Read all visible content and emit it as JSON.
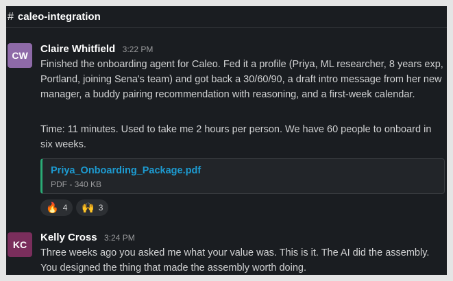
{
  "channel": {
    "hash": "#",
    "name": "caleo-integration"
  },
  "messages": [
    {
      "avatar_initials": "CW",
      "avatar_color": "#8e6aa8",
      "author": "Claire Whitfield",
      "time": "3:22 PM",
      "paragraphs": [
        "Finished the onboarding agent for Caleo. Fed it a profile (Priya, ML researcher, 8 years exp, Portland, joining Sena's team) and got back a 30/60/90, a draft intro message from her new manager, a buddy pairing recommendation with reasoning, and a first-week calendar.",
        "Time: 11 minutes. Used to take me 2 hours per person. We have 60 people to onboard in six weeks."
      ],
      "attachment": {
        "name": "Priya_Onboarding_Package.pdf",
        "meta": "PDF - 340 KB"
      },
      "reactions": [
        {
          "emoji": "🔥",
          "count": "4"
        },
        {
          "emoji": "🙌",
          "count": "3"
        }
      ]
    },
    {
      "avatar_initials": "KC",
      "avatar_color": "#7a2e5c",
      "author": "Kelly Cross",
      "time": "3:24 PM",
      "paragraphs": [
        "Three weeks ago you asked me what your value was. This is it. The AI did the assembly. You designed the thing that made the assembly worth doing."
      ]
    }
  ],
  "colors": {
    "background": "#1a1d21",
    "link": "#1d9bd1",
    "attachment_accent": "#2bac76"
  }
}
